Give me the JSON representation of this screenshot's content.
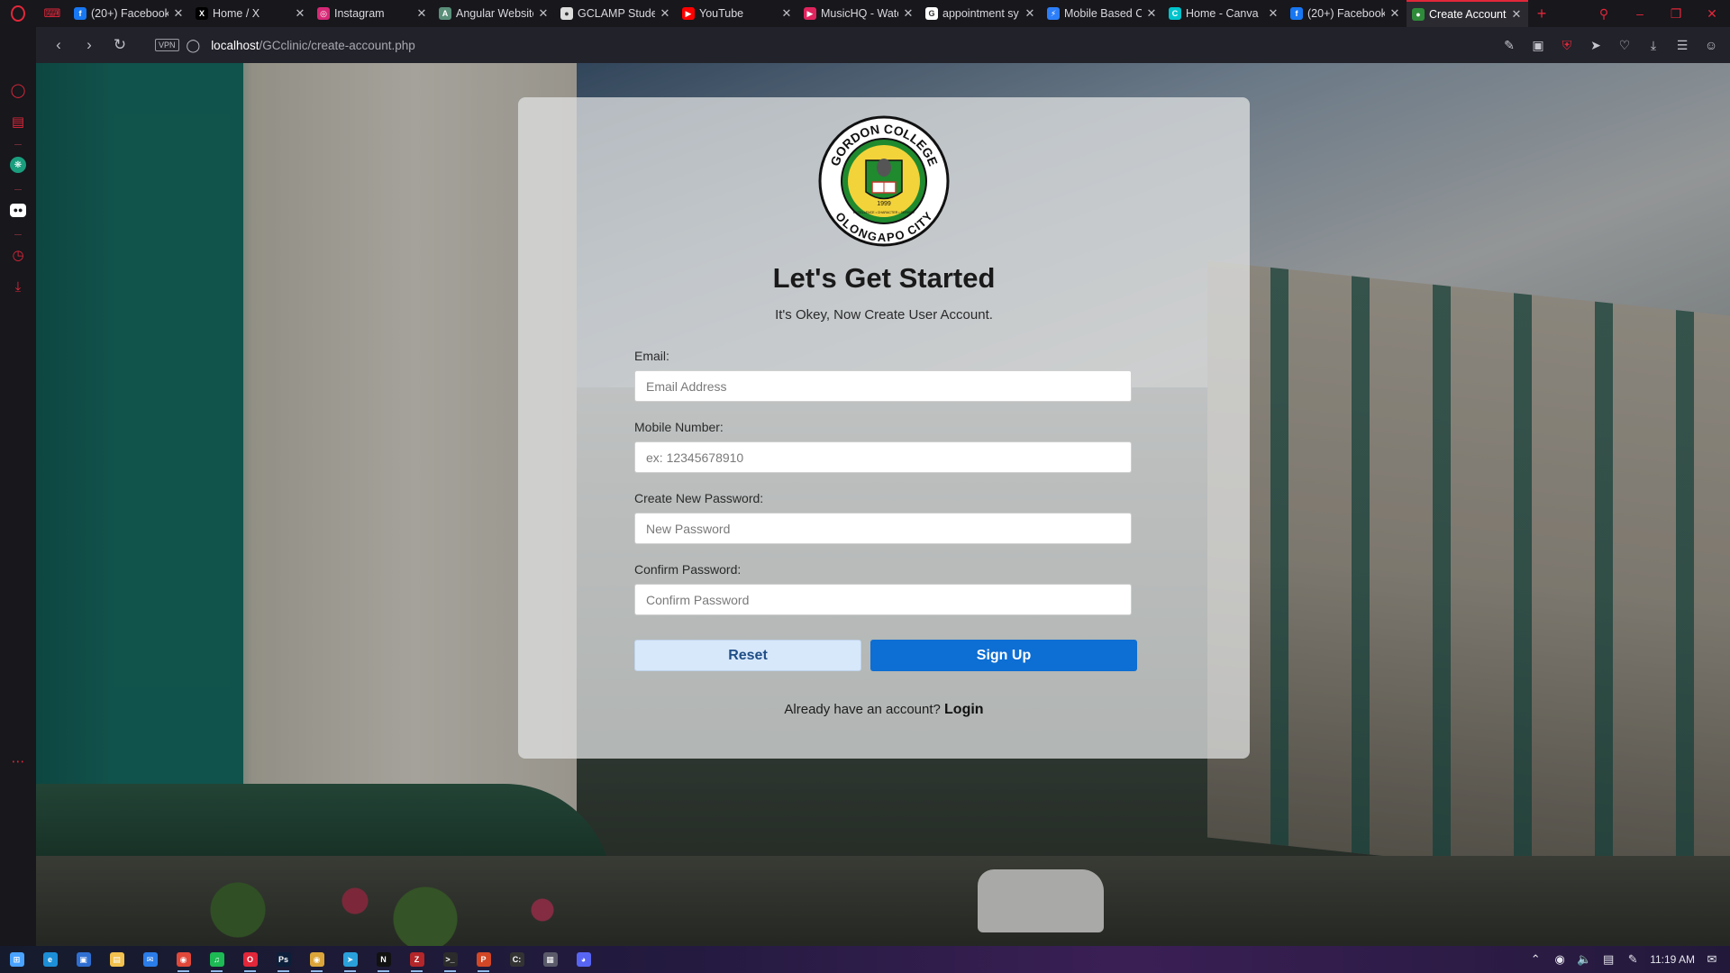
{
  "browser": {
    "tabs": [
      {
        "label": "(20+) Facebook",
        "favicon": "facebook-icon",
        "color": "#1877f2"
      },
      {
        "label": "Home / X",
        "favicon": "x-icon",
        "color": "#000000"
      },
      {
        "label": "Instagram",
        "favicon": "instagram-icon",
        "color": "#d62976"
      },
      {
        "label": "Angular Website",
        "favicon": "angular-icon",
        "color": "#5a8f7a"
      },
      {
        "label": "GCLAMP Student",
        "favicon": "gclamp-icon",
        "color": "#dddddd"
      },
      {
        "label": "YouTube",
        "favicon": "youtube-icon",
        "color": "#ff0000"
      },
      {
        "label": "MusicHQ - Watch",
        "favicon": "musichq-icon",
        "color": "#e0245e"
      },
      {
        "label": "appointment sy",
        "favicon": "google-icon",
        "color": "#ffffff"
      },
      {
        "label": "Mobile Based C",
        "favicon": "bolt-icon",
        "color": "#2d7ff9"
      },
      {
        "label": "Home - Canva",
        "favicon": "canva-icon",
        "color": "#00c4cc"
      },
      {
        "label": "(20+) Facebook",
        "favicon": "facebook-icon",
        "color": "#1877f2"
      },
      {
        "label": "Create Account",
        "favicon": "gordon-college-icon",
        "color": "#2e8b3a"
      }
    ],
    "url_host": "localhost",
    "url_path": "/GCclinic/create-account.php",
    "vpn_label": "VPN"
  },
  "form": {
    "title": "Let's Get Started",
    "subtitle": "It's Okey, Now Create User Account.",
    "email_label": "Email:",
    "email_placeholder": "Email Address",
    "mobile_label": "Mobile Number:",
    "mobile_placeholder": "ex: 12345678910",
    "new_password_label": "Create New Password:",
    "new_password_placeholder": "New Password",
    "confirm_password_label": "Confirm Password:",
    "confirm_password_placeholder": "Confirm Password",
    "reset_label": "Reset",
    "signup_label": "Sign Up",
    "login_prompt": "Already have an account? ",
    "login_link": "Login"
  },
  "logo": {
    "top_text": "GORDON COLLEGE",
    "bottom_text": "OLONGAPO CITY",
    "year": "1999",
    "motto": "EXCELLENCE • CHARACTER • SERVICE"
  },
  "taskbar": {
    "apps": [
      "windows-start",
      "edge",
      "store",
      "file-explorer",
      "mail",
      "chrome",
      "spotify",
      "opera-gx",
      "photoshop",
      "chrome-profile",
      "telegram",
      "netflix",
      "filezilla",
      "terminal",
      "powerpoint",
      "cmd",
      "vpn-app",
      "discord"
    ],
    "time": "11:19 AM"
  },
  "colors": {
    "accent": "#e2273a",
    "signup": "#0d6ed3",
    "reset_bg": "#d7e8fb"
  }
}
